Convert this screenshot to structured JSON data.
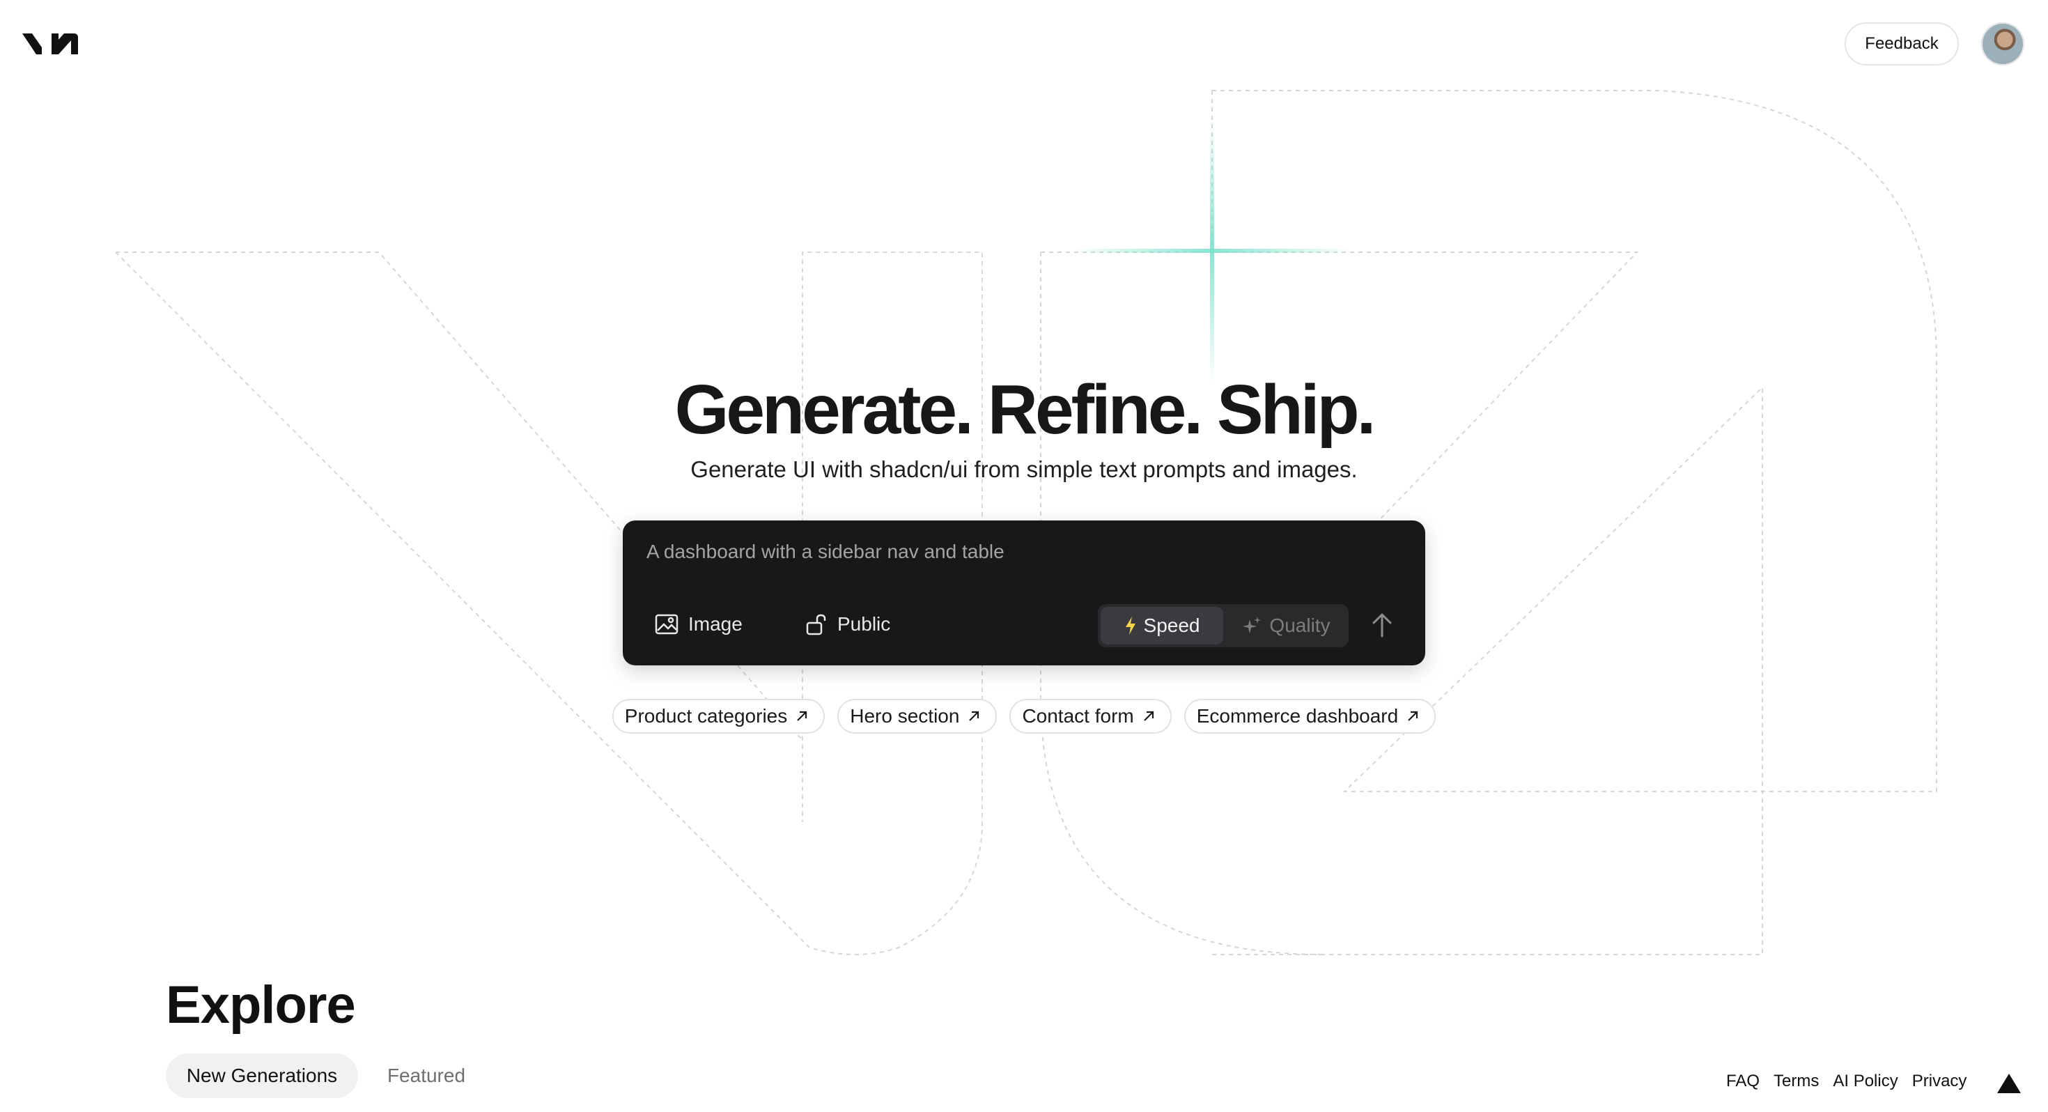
{
  "header": {
    "logo_name": "v0 logo",
    "feedback_label": "Feedback",
    "avatar_name": "user avatar"
  },
  "hero": {
    "title": "Generate. Refine. Ship.",
    "subtitle": "Generate UI with shadcn/ui from simple text prompts and images."
  },
  "prompt": {
    "placeholder": "A dashboard with a sidebar nav and table",
    "value": "",
    "image_label": "Image",
    "image_icon": "image-icon",
    "public_label": "Public",
    "public_icon": "unlock-icon",
    "speed_label": "Speed",
    "speed_icon": "lightning-icon",
    "quality_label": "Quality",
    "quality_icon": "sparkles-icon",
    "send_icon": "arrow-up-icon",
    "selected_mode": "Speed"
  },
  "suggestions": [
    {
      "label": "Product categories",
      "icon": "arrow-up-right-icon"
    },
    {
      "label": "Hero section",
      "icon": "arrow-up-right-icon"
    },
    {
      "label": "Contact form",
      "icon": "arrow-up-right-icon"
    },
    {
      "label": "Ecommerce dashboard",
      "icon": "arrow-up-right-icon"
    }
  ],
  "explore": {
    "title": "Explore",
    "tabs": [
      {
        "label": "New Generations",
        "active": true
      },
      {
        "label": "Featured",
        "active": false
      }
    ]
  },
  "footer": {
    "links": [
      "FAQ",
      "Terms",
      "AI Policy",
      "Privacy"
    ],
    "brand_icon": "vercel-triangle-icon"
  },
  "colors": {
    "prompt_bg": "#18181a",
    "accent_glow": "#7ee0cc",
    "speed_bolt": "#f5d547"
  }
}
